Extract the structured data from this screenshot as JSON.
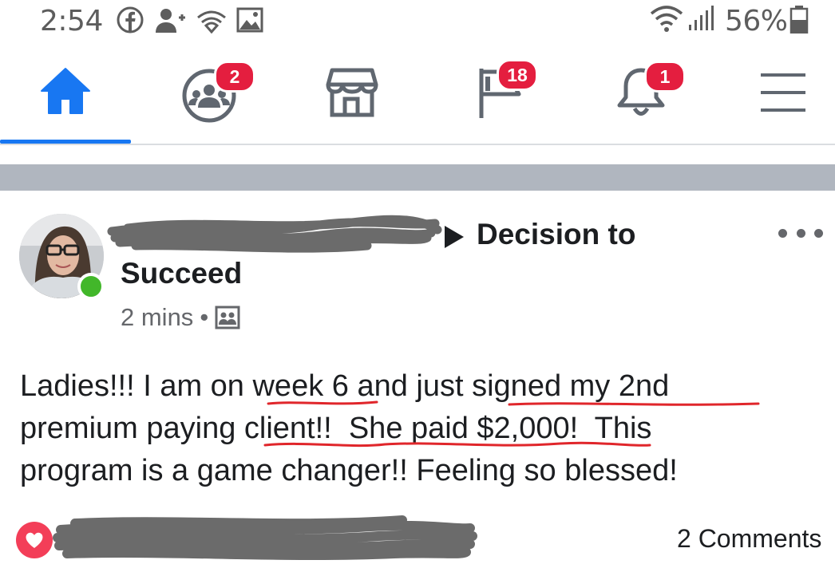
{
  "status_bar": {
    "time": "2:54",
    "battery_text": "56%",
    "left_icons": [
      "facebook-icon",
      "add-friend-icon",
      "wifi-hotspot-icon",
      "image-icon"
    ],
    "right_icons": [
      "wifi-icon",
      "signal-icon",
      "battery-icon"
    ]
  },
  "nav": {
    "items": [
      {
        "icon": "home-icon",
        "active": true
      },
      {
        "icon": "groups-icon",
        "badge": "2"
      },
      {
        "icon": "marketplace-icon"
      },
      {
        "icon": "pages-flag-icon",
        "badge": "18"
      },
      {
        "icon": "notifications-bell-icon",
        "badge": "1"
      },
      {
        "icon": "menu-icon"
      }
    ],
    "accent_color": "#1877f2",
    "badge_color": "#e41e3f"
  },
  "post": {
    "group_name_line1": "Decision to",
    "group_name_line2": "Succeed",
    "timestamp": "2 mins",
    "separator": "•",
    "audience_icon": "group-audience-icon",
    "body_lines": [
      "Ladies!!! I am on week 6 and just signed my 2nd",
      "premium paying client!!  She paid $2,000!  This",
      "program is a game changer!! Feeling so blessed!"
    ],
    "reaction_icon": "love-reaction-icon",
    "comments": "2 Comments"
  }
}
